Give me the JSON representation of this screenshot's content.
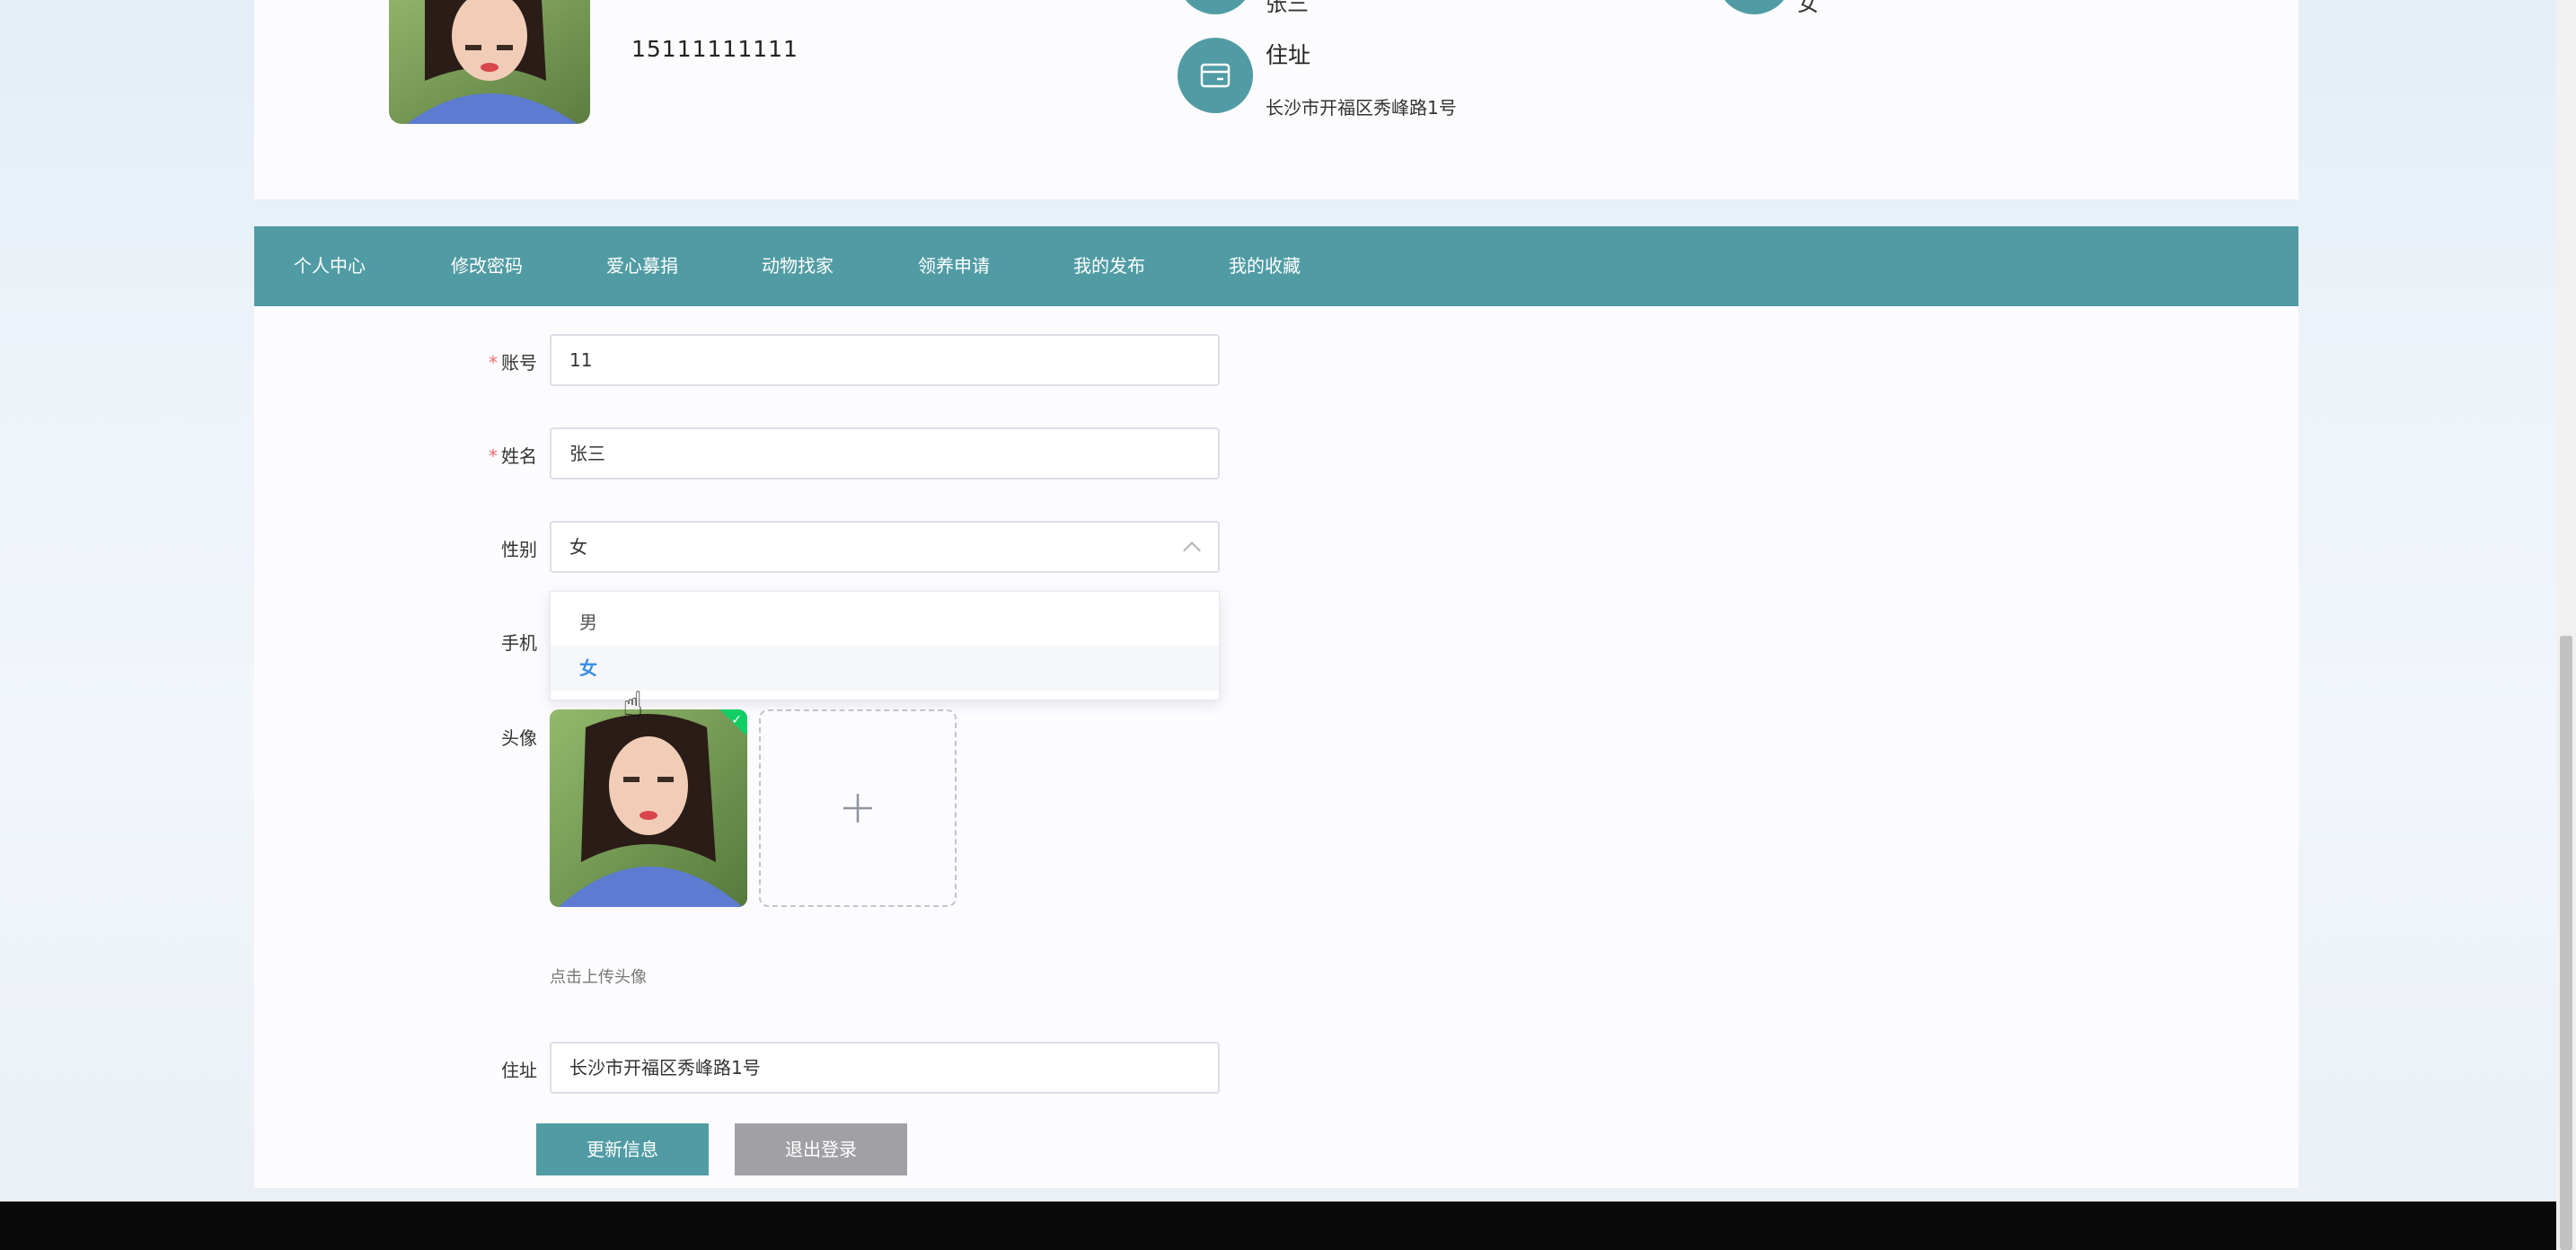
{
  "profile": {
    "phone": "15111111111",
    "address_label": "住址",
    "address_value": "长沙市开福区秀峰路1号",
    "name_partial": "张三",
    "gender_partial": "女"
  },
  "nav": {
    "items": [
      "个人中心",
      "修改密码",
      "爱心募捐",
      "动物找家",
      "领养申请",
      "我的发布",
      "我的收藏"
    ]
  },
  "form": {
    "account": {
      "label": "账号",
      "value": "11"
    },
    "name": {
      "label": "姓名",
      "value": "张三"
    },
    "gender": {
      "label": "性别",
      "value": "女",
      "options": [
        "男",
        "女"
      ]
    },
    "phone": {
      "label": "手机"
    },
    "avatar": {
      "label": "头像",
      "tip": "点击上传头像"
    },
    "address": {
      "label": "住址",
      "value": "长沙市开福区秀峰路1号"
    },
    "update_button": "更新信息",
    "logout_button": "退出登录"
  },
  "colors": {
    "accent": "#519ca4",
    "required": "#f56c6c",
    "selected_option": "#3a8ee6",
    "success": "#13ce66",
    "logout": "#a0a0a5"
  }
}
